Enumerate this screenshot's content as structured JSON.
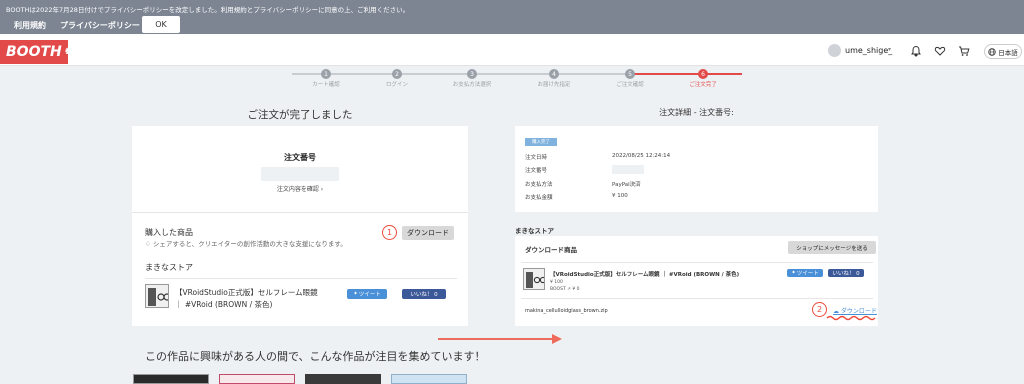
{
  "notice": {
    "text": "BOOTHは2022年7月28日付けでプライバシーポリシーを改定しました。利用規約とプライバシーポリシーに同意の上、ご利用ください。",
    "terms_label": "利用規約",
    "privacy_label": "プライバシーポリシー",
    "ok_label": "OK"
  },
  "header": {
    "logo_text": "BOOTH",
    "username": "ume_shige_",
    "language": "日本語"
  },
  "steps": [
    {
      "num": "1",
      "label": "カート確認"
    },
    {
      "num": "2",
      "label": "ログイン"
    },
    {
      "num": "3",
      "label": "お支払方法選択"
    },
    {
      "num": "4",
      "label": "お届け先指定"
    },
    {
      "num": "5",
      "label": "ご注文確認"
    },
    {
      "num": "6",
      "label": "ご注文完了"
    }
  ],
  "left": {
    "title": "ご注文が完了しました",
    "order_number_label": "注文番号",
    "order_details_link": "注文内容を確認 ›",
    "purchased_label": "購入した商品",
    "share_note": "シェアすると、クリエイターの創作活動の大きな支援になります。",
    "download_button": "ダウンロード",
    "marker_1": "1",
    "store_name": "まきなストア",
    "item_title": "【VRoidStudio正式版】セルフレーム眼鏡 ｜ #VRoid (BROWN / 茶色)",
    "tweet_label": "ツイート",
    "like_label": "いいね！ 0"
  },
  "right": {
    "title": "注文詳細 - 注文番号:",
    "status_badge": "購入完了",
    "details": [
      {
        "label": "注文日時",
        "value": "2022/08/25 12:24:14"
      },
      {
        "label": "注文番号",
        "value": ""
      },
      {
        "label": "お支払方法",
        "value": "PayPal決済"
      },
      {
        "label": "お支払金額",
        "value": "¥ 100"
      }
    ],
    "store_name": "まきなストア",
    "download_products_label": "ダウンロード商品",
    "message_button": "ショップにメッセージを送る",
    "item_title": "【VRoidStudio正式版】セルフレーム眼鏡 ｜ #VRoid (BROWN / 茶色)",
    "item_price": "¥ 100",
    "boost_text": "BOOST ↗ ¥ 0",
    "tweet_label": "ツイート",
    "like_label": "いいね！ 0",
    "file_name": "makina_cellulloidglass_brown.zip",
    "download_link": "ダウンロード",
    "marker_2": "2"
  },
  "recommend_text": "この作品に興味がある人の間で、こんな作品が注目を集めています！",
  "colors": {
    "accent": "#e24a4a",
    "notice_bg": "#7d8593",
    "annotation": "#ee4a3a"
  }
}
